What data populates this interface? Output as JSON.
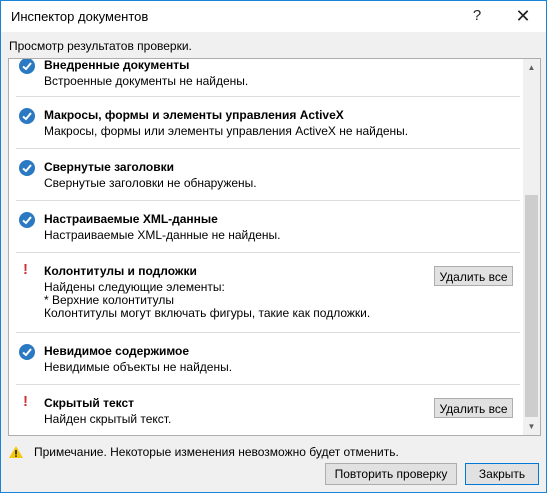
{
  "window": {
    "title": "Инспектор документов",
    "help_glyph": "?",
    "close_glyph": "✕"
  },
  "subtitle": "Просмотр результатов проверки.",
  "items": [
    {
      "status": "ok",
      "title": "Внедренные документы",
      "lines": [
        "Встроенные документы не найдены."
      ]
    },
    {
      "status": "ok",
      "title": "Макросы, формы и элементы управления ActiveX",
      "lines": [
        "Макросы, формы или элементы управления ActiveX не найдены."
      ]
    },
    {
      "status": "ok",
      "title": "Свернутые заголовки",
      "lines": [
        "Свернутые заголовки не обнаружены."
      ]
    },
    {
      "status": "ok",
      "title": "Настраиваемые XML-данные",
      "lines": [
        "Настраиваемые XML-данные не найдены."
      ]
    },
    {
      "status": "warn",
      "title": "Колонтитулы и подложки",
      "lines": [
        "Найдены следующие элементы:",
        "* Верхние колонтитулы",
        "Колонтитулы могут включать фигуры, такие как подложки."
      ],
      "button": "Удалить все"
    },
    {
      "status": "ok",
      "title": "Невидимое содержимое",
      "lines": [
        "Невидимые объекты не найдены."
      ]
    },
    {
      "status": "warn",
      "title": "Скрытый текст",
      "lines": [
        "Найден скрытый текст."
      ],
      "button": "Удалить все"
    }
  ],
  "warn_glyph": "!",
  "note": "Примечание. Некоторые изменения невозможно будет отменить.",
  "buttons": {
    "recheck": "Повторить проверку",
    "close": "Закрыть"
  },
  "colors": {
    "check": "#2b79c2",
    "warn": "#d13438",
    "accent": "#0078d7"
  }
}
